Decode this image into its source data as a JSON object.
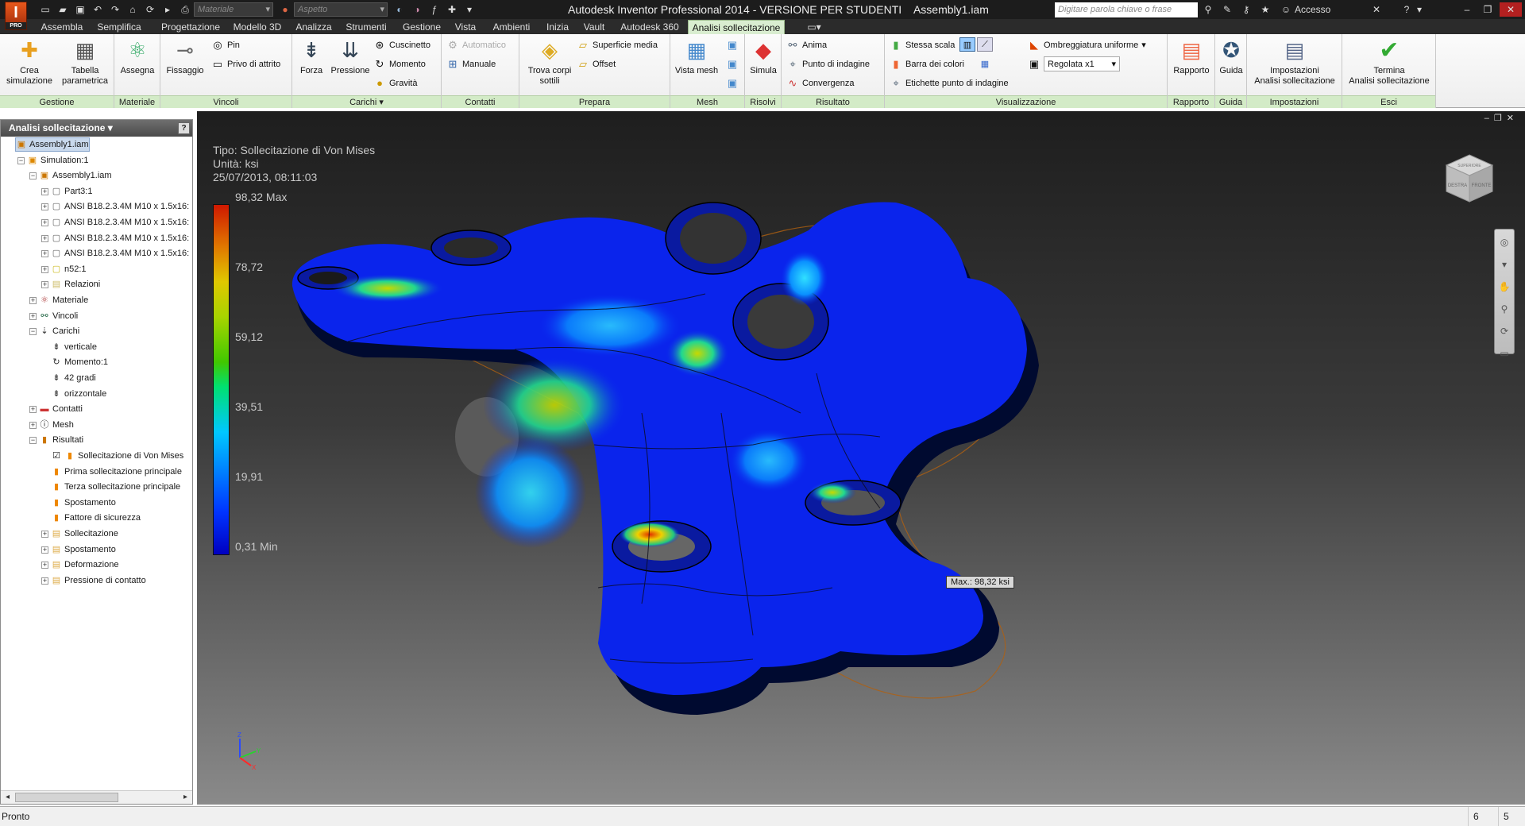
{
  "title_bar": {
    "app_title": "Autodesk Inventor Professional 2014 - VERSIONE PER STUDENTI    Assembly1.iam",
    "logo_letter": "I",
    "logo_badge": "PRO",
    "material_select": "Materiale",
    "appearance_select": "Aspetto",
    "search_placeholder": "Digitare parola chiave o frase",
    "sign_in": "Accesso"
  },
  "ribbon_tabs": [
    "Assembla",
    "Semplifica",
    "Progettazione",
    "Modello 3D",
    "Analizza",
    "Strumenti",
    "Gestione",
    "Vista",
    "Ambienti",
    "Inizia",
    "Vault",
    "Autodesk 360",
    "Analisi sollecitazione"
  ],
  "active_tab": "Analisi sollecitazione",
  "ribbon": {
    "gestione": {
      "title": "Gestione",
      "crea": "Crea\nsimulazione",
      "tabella": "Tabella\nparametrica"
    },
    "materiale": {
      "title": "Materiale",
      "assegna": "Assegna"
    },
    "vincoli": {
      "title": "Vincoli",
      "fissaggio": "Fissaggio",
      "pin": "Pin",
      "privo": "Privo di attrito"
    },
    "carichi": {
      "title": "Carichi",
      "forza": "Forza",
      "pressione": "Pressione",
      "cuscinetto": "Cuscinetto",
      "momento": "Momento",
      "gravita": "Gravità"
    },
    "contatti": {
      "title": "Contatti",
      "automatico": "Automatico",
      "manuale": "Manuale"
    },
    "prepara": {
      "title": "Prepara",
      "trova": "Trova corpi\nsottili",
      "superficie": "Superficie media",
      "offset": "Offset"
    },
    "mesh": {
      "title": "Mesh",
      "vista": "Vista mesh"
    },
    "risolvi": {
      "title": "Risolvi",
      "simula": "Simula"
    },
    "risultato": {
      "title": "Risultato",
      "anima": "Anima",
      "punto": "Punto di indagine",
      "convergenza": "Convergenza"
    },
    "visualizzazione": {
      "title": "Visualizzazione",
      "stessa_scala": "Stessa scala",
      "barra_colori": "Barra dei colori",
      "etichette": "Etichette punto di indagine",
      "ombreggiatura": "Ombreggiatura uniforme",
      "regolata": "Regolata x1"
    },
    "rapporto": {
      "title": "Rapporto",
      "rapporto": "Rapporto"
    },
    "guida": {
      "title": "Guida",
      "guida": "Guida"
    },
    "impostazioni": {
      "title": "Impostazioni",
      "impostazioni": "Impostazioni\nAnalisi sollecitazione"
    },
    "esci": {
      "title": "Esci",
      "termina": "Termina\nAnalisi sollecitazione"
    }
  },
  "browser": {
    "header": "Analisi sollecitazione",
    "nodes": [
      {
        "label": "Assembly1.iam",
        "level": 0,
        "icon": "assembly-icon"
      },
      {
        "label": "Simulation:1",
        "level": 1,
        "icon": "simulation-icon"
      },
      {
        "label": "Assembly1.iam",
        "level": 2,
        "icon": "assembly-icon"
      },
      {
        "label": "Part3:1",
        "level": 3,
        "icon": "part-icon"
      },
      {
        "label": "ANSI B18.2.3.4M M10 x 1.5x16:",
        "level": 3,
        "icon": "part-icon"
      },
      {
        "label": "ANSI B18.2.3.4M M10 x 1.5x16:",
        "level": 3,
        "icon": "part-icon"
      },
      {
        "label": "ANSI B18.2.3.4M M10 x 1.5x16:",
        "level": 3,
        "icon": "part-icon"
      },
      {
        "label": "ANSI B18.2.3.4M M10 x 1.5x16:",
        "level": 3,
        "icon": "part-icon"
      },
      {
        "label": "n52:1",
        "level": 3,
        "icon": "part-yellow-icon"
      },
      {
        "label": "Relazioni",
        "level": 3,
        "icon": "folder-icon"
      },
      {
        "label": "Materiale",
        "level": 2,
        "icon": "material-icon"
      },
      {
        "label": "Vincoli",
        "level": 2,
        "icon": "constraint-icon"
      },
      {
        "label": "Carichi",
        "level": 2,
        "icon": "loads-icon"
      },
      {
        "label": "verticale",
        "level": 3,
        "icon": "force-icon"
      },
      {
        "label": "Momento:1",
        "level": 3,
        "icon": "moment-icon"
      },
      {
        "label": "42 gradi",
        "level": 3,
        "icon": "force-icon"
      },
      {
        "label": "orizzontale",
        "level": 3,
        "icon": "force-icon"
      },
      {
        "label": "Contatti",
        "level": 2,
        "icon": "contacts-icon"
      },
      {
        "label": "Mesh",
        "level": 2,
        "icon": "mesh-icon"
      },
      {
        "label": "Risultati",
        "level": 2,
        "icon": "results-icon"
      },
      {
        "label": "Sollecitazione di Von Mises",
        "level": 3,
        "icon": "result-checked-icon"
      },
      {
        "label": "Prima sollecitazione principale",
        "level": 3,
        "icon": "result-icon"
      },
      {
        "label": "Terza sollecitazione principale",
        "level": 3,
        "icon": "result-icon"
      },
      {
        "label": "Spostamento",
        "level": 3,
        "icon": "result-icon"
      },
      {
        "label": "Fattore di sicurezza",
        "level": 3,
        "icon": "result-icon"
      },
      {
        "label": "Sollecitazione",
        "level": 3,
        "icon": "result-folder-icon"
      },
      {
        "label": "Spostamento",
        "level": 3,
        "icon": "result-folder-icon"
      },
      {
        "label": "Deformazione",
        "level": 3,
        "icon": "result-folder-icon"
      },
      {
        "label": "Pressione di contatto",
        "level": 3,
        "icon": "result-folder-icon"
      }
    ]
  },
  "viewport": {
    "type_line": "Tipo: Sollecitazione di Von Mises",
    "unit_line": "Unità: ksi",
    "date_line": "25/07/2013, 08:11:03",
    "scale_max": "98,32 Max",
    "scale_ticks": [
      "78,72",
      "59,12",
      "39,51",
      "19,91"
    ],
    "scale_min": "0,31 Min",
    "max_label": "Max.: 98,32 ksi",
    "viewcube_top": "SUPERIORE",
    "viewcube_left": "DESTRA",
    "viewcube_right": "FRONTE"
  },
  "status": {
    "text": "Pronto",
    "num1": "6",
    "num2": "5"
  }
}
